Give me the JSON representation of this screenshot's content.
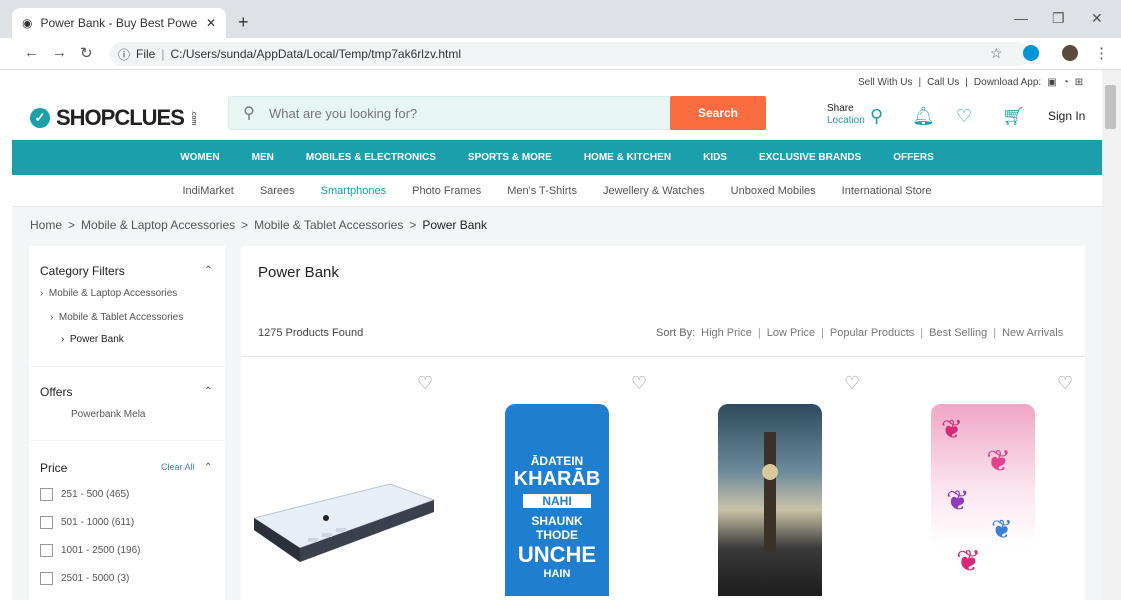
{
  "browser": {
    "tab_title": "Power Bank - Buy Best Power Bar",
    "url_label": "File",
    "url": "C:/Users/sunda/AppData/Local/Temp/tmp7ak6rlzv.html"
  },
  "top_links": [
    "Sell With Us",
    "|",
    "Call Us",
    "|",
    "Download App:"
  ],
  "logo": "SHOPCLUES",
  "logo_suffix": ".com",
  "search": {
    "placeholder": "What are you looking for?",
    "button": "Search"
  },
  "header": {
    "share": "Share",
    "location": "Location",
    "signin": "Sign In"
  },
  "categories": [
    "WOMEN",
    "MEN",
    "MOBILES & ELECTRONICS",
    "SPORTS & MORE",
    "HOME & KITCHEN",
    "KIDS",
    "EXCLUSIVE BRANDS",
    "OFFERS"
  ],
  "subcategories": [
    "IndiMarket",
    "Sarees",
    "Smartphones",
    "Photo Frames",
    "Men's T-Shirts",
    "Jewellery & Watches",
    "Unboxed Mobiles",
    "International Store"
  ],
  "breadcrumb": [
    "Home",
    ">",
    "Mobile & Laptop Accessories",
    ">",
    "Mobile & Tablet Accessories",
    ">",
    "Power Bank"
  ],
  "filters": {
    "category_title": "Category Filters",
    "category_items": [
      "Mobile & Laptop Accessories",
      "Mobile & Tablet Accessories",
      "Power Bank"
    ],
    "offers_title": "Offers",
    "offers_item": "Powerbank Mela",
    "price_title": "Price",
    "clear_all": "Clear All",
    "price_items": [
      "251 - 500 (465)",
      "501 - 1000 (611)",
      "1001 - 2500 (196)",
      "2501 - 5000 (3)"
    ]
  },
  "main": {
    "title": "Power Bank",
    "found": "1275 Products Found",
    "sort_label": "Sort By:",
    "sort_options": [
      "High Price",
      "Low Price",
      "Popular Products",
      "Best Selling",
      "New Arrivals"
    ]
  },
  "product_texts": {
    "p2_line1": "ĀDATEIN",
    "p2_line2": "KHARĀB",
    "p2_line3": "NAHI",
    "p2_line4": "SHAUNK",
    "p2_line5": "THODE",
    "p2_line6": "UNCHE",
    "p2_line7": "HAIN"
  },
  "colors": {
    "brand": "#1b9fac",
    "accent": "#fa6c3f"
  }
}
